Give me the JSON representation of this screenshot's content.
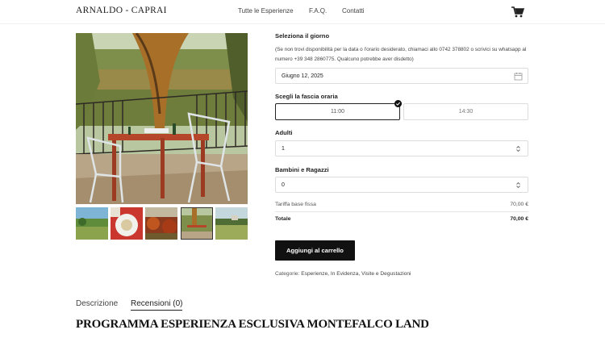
{
  "header": {
    "brand": "ARNALDO - CAPRAI",
    "nav": [
      "Tutte le Esperienze",
      "F.A.Q.",
      "Contatti"
    ],
    "cart_icon": "shopping-cart-icon"
  },
  "gallery": {
    "main_image": "vineyard-terrace-table-photo",
    "thumbnails": [
      "vineyard-landscape-thumb",
      "plate-food-thumb",
      "autumn-vines-thumb",
      "terrace-table-thumb",
      "vineyard-field-thumb"
    ],
    "selected_index": 3
  },
  "booking": {
    "day_label": "Seleziona il giorno",
    "note": "(Se non trovi disponibilità per la data o l'orario desiderato, chiamaci allo 0742 378802 o scrivici su whatsapp al numero +39 348 2860775. Qualcuno potrebbe aver disdetto)",
    "date_value": "Giugno 12, 2025",
    "time_label": "Scegli la fascia oraria",
    "time_slots": [
      "11:00",
      "14:30"
    ],
    "selected_slot": 0,
    "adults_label": "Adulti",
    "adults_value": "1",
    "kids_label": "Bambini e Ragazzi",
    "kids_value": "0",
    "fee_label": "Tariffa base fissa",
    "fee_value": "70,00 €",
    "total_label": "Totale",
    "total_value": "70,00 €",
    "add_to_cart": "Aggiungi al carrello",
    "categories_label": "Categorie:",
    "categories": "Esperienze, In Evidenza, Visite e Degustazioni"
  },
  "tabs": [
    "Descrizione",
    "Recensioni (0)"
  ],
  "section_title": "PROGRAMMA ESPERIENZA ESCLUSIVA MONTEFALCO LAND"
}
